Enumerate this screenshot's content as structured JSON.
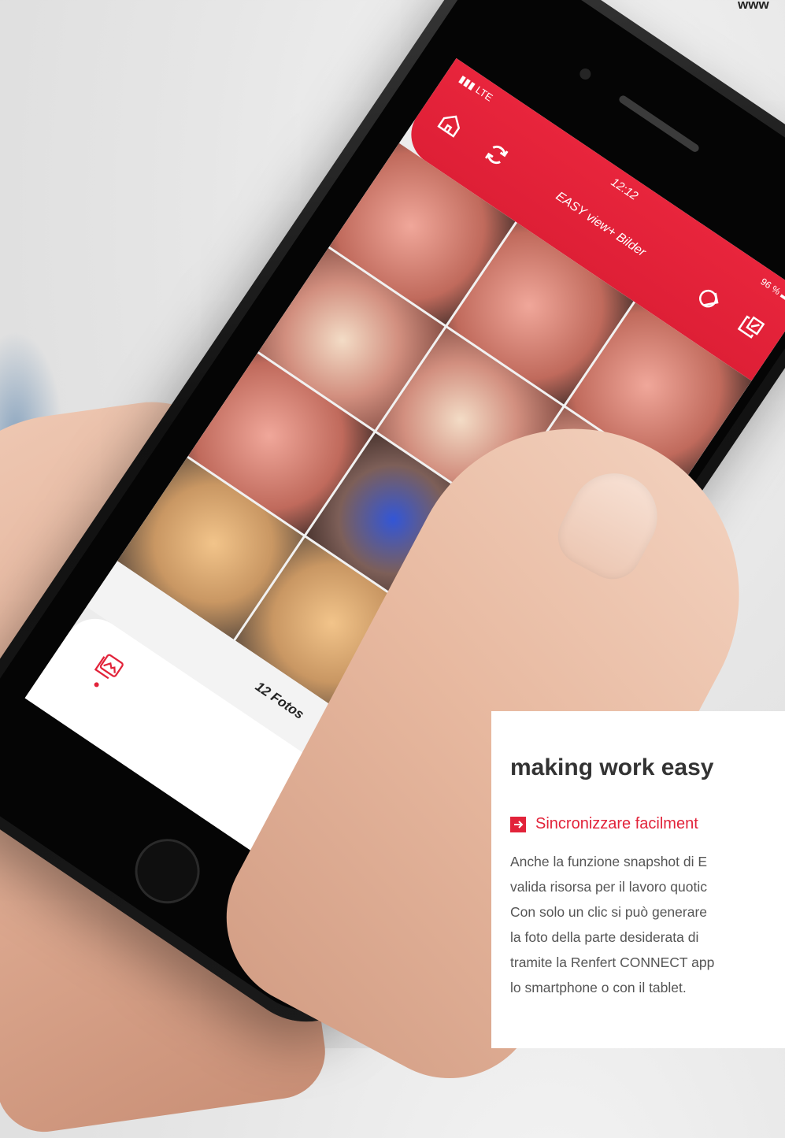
{
  "corner_url": "www",
  "phone": {
    "status": {
      "carrier": "LTE",
      "time": "12:12",
      "battery": "96 %"
    },
    "app_title": "EASY view+ Bilder",
    "toolbar": [
      "home-icon",
      "refresh-icon",
      "edit-icon",
      "export-icon"
    ],
    "photo_count": "12 Fotos",
    "bottom_tab": "gallery-icon"
  },
  "info": {
    "heading": "making work easy",
    "bullet": "Sincronizzare facilment",
    "body_lines": [
      "Anche la funzione snapshot di E",
      "valida risorsa per il lavoro quotic",
      "Con solo un clic si può generare",
      "la foto della parte desiderata di",
      "tramite la Renfert CONNECT app",
      "lo smartphone o con il tablet."
    ]
  },
  "colors": {
    "brand_red": "#e2233a",
    "text_gray": "#555555"
  }
}
